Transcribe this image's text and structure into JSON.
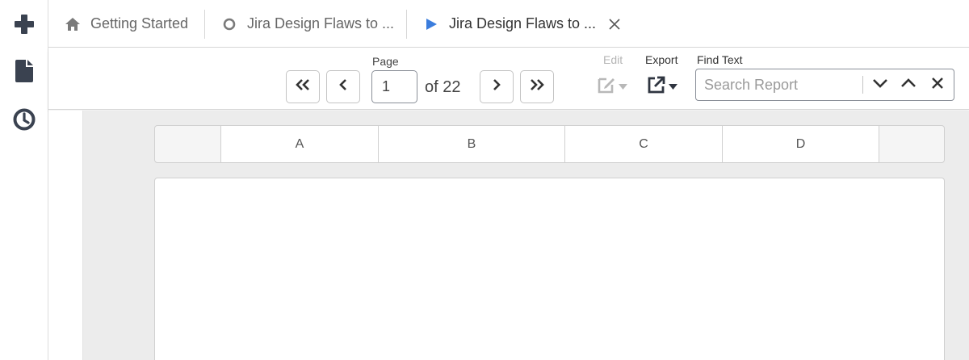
{
  "rail": {
    "items": [
      {
        "icon": "plus-icon"
      },
      {
        "icon": "document-icon"
      },
      {
        "icon": "clock-icon"
      }
    ]
  },
  "tabs": [
    {
      "label": "Getting Started",
      "icon": "home-icon"
    },
    {
      "label": "Jira Design Flaws to ...",
      "icon": "circle-icon"
    },
    {
      "label": "Jira Design Flaws to ...",
      "icon": "play-icon",
      "active": true
    }
  ],
  "toolbar": {
    "page_label": "Page",
    "page_value": "1",
    "page_of": "of 22",
    "edit_label": "Edit",
    "export_label": "Export",
    "find_label": "Find Text",
    "search_placeholder": "Search Report"
  },
  "columns": [
    "A",
    "B",
    "C",
    "D"
  ],
  "colors": {
    "accent": "#3b7ddd",
    "icon": "#3a4250",
    "muted_icon": "#b8b8b8",
    "canvas": "#ececec"
  }
}
